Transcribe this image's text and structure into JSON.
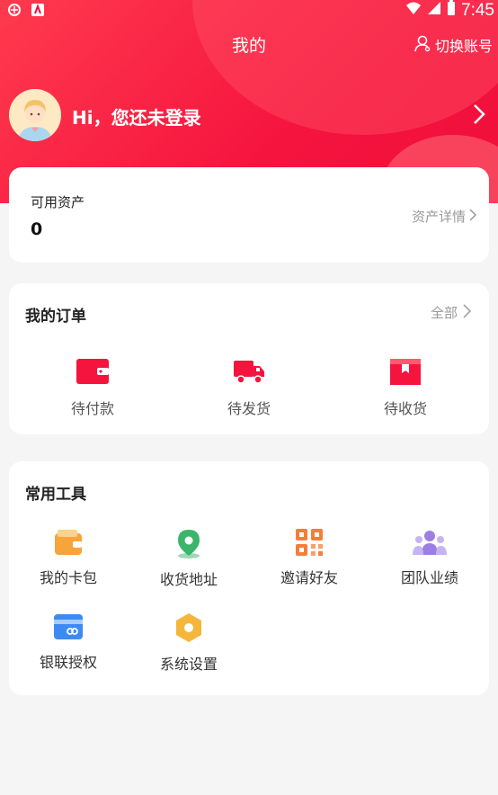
{
  "status_bar": {
    "time": "7:45"
  },
  "header": {
    "title": "我的",
    "switch_account": "切换账号",
    "greeting": "Hi，您还未登录"
  },
  "assets": {
    "label": "可用资产",
    "value": "0",
    "details_link": "资产详情"
  },
  "orders": {
    "title": "我的订单",
    "all_link": "全部",
    "items": [
      {
        "label": "待付款",
        "icon": "wallet-icon"
      },
      {
        "label": "待发货",
        "icon": "truck-icon"
      },
      {
        "label": "待收货",
        "icon": "box-icon"
      }
    ]
  },
  "tools": {
    "title": "常用工具",
    "items": [
      {
        "label": "我的卡包",
        "icon": "card-wallet-icon"
      },
      {
        "label": "收货地址",
        "icon": "location-pin-icon"
      },
      {
        "label": "邀请好友",
        "icon": "qr-code-icon"
      },
      {
        "label": "团队业绩",
        "icon": "team-icon"
      },
      {
        "label": "银联授权",
        "icon": "unionpay-card-icon"
      },
      {
        "label": "系统设置",
        "icon": "settings-hexagon-icon"
      }
    ]
  },
  "colors": {
    "brand": "#f5143e",
    "orange": "#f7a43a",
    "green": "#3bb56b",
    "purple": "#9b7fe6",
    "blue": "#3d8bf2"
  }
}
